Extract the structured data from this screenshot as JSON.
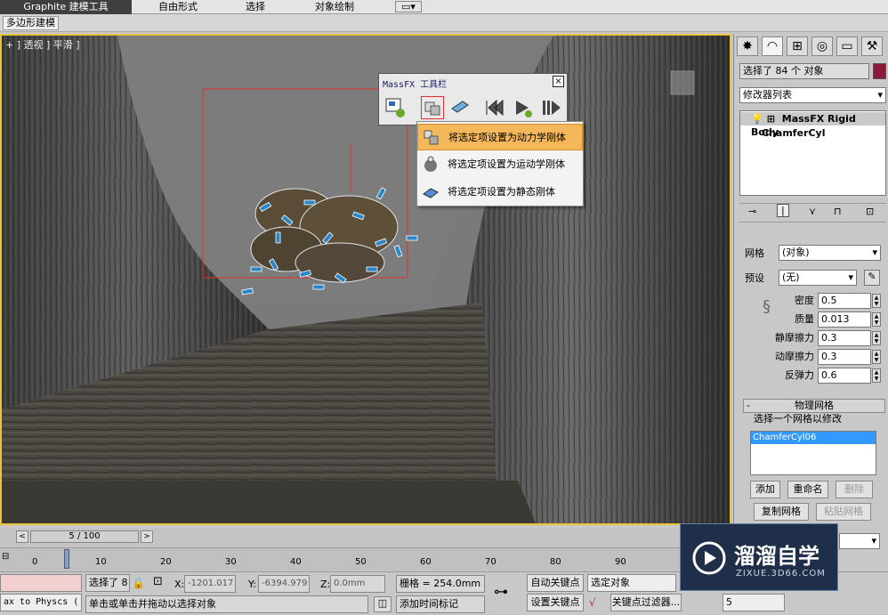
{
  "ribbon": {
    "tabs": [
      "Graphite 建模工具",
      "自由形式",
      "选择",
      "对象绘制"
    ],
    "sub_tab": "多边形建模"
  },
  "viewport": {
    "label": "+ ] 透视 ] 平滑 ]"
  },
  "massfx": {
    "title": "MassFX 工具栏",
    "close": "×"
  },
  "context_menu": {
    "items": [
      "将选定项设置为动力学刚体",
      "将选定项设置为运动学刚体",
      "将选定项设置为静态刚体"
    ]
  },
  "panel": {
    "selection_text": "选择了 84 个 对象",
    "modifier_list": "修改器列表",
    "stack": [
      "MassFX Rigid Body",
      "ChamferCyl"
    ],
    "mesh_label": "网格",
    "mesh_value": "(对象)",
    "preset_label": "预设",
    "preset_value": "(无)",
    "props": [
      {
        "label": "密度",
        "value": "0.5"
      },
      {
        "label": "质量",
        "value": "0.013"
      },
      {
        "label": "静摩擦力",
        "value": "0.3"
      },
      {
        "label": "动摩擦力",
        "value": "0.3"
      },
      {
        "label": "反弹力",
        "value": "0.6"
      }
    ],
    "rollout_title": "物理网格",
    "rollout_minus": "-",
    "select_mesh_label": "选择一个网格以修改",
    "mesh_list_item": "ChamferCyl06",
    "buttons": [
      "添加",
      "重命名",
      "删除",
      "复制网格",
      "粘贴网格"
    ]
  },
  "timeline": {
    "frame": "5 / 100",
    "ticks": [
      "0",
      "10",
      "20",
      "30",
      "40",
      "50",
      "60",
      "70",
      "80",
      "90"
    ]
  },
  "status": {
    "left_field": "ax to Physcs (",
    "selected": "选择了 8",
    "x_label": "X:",
    "x_value": "-1201.017",
    "y_label": "Y:",
    "y_value": "-6394.979",
    "z_label": "Z:",
    "z_value": "0.0mm",
    "grid": "栅格 = 254.0mm",
    "prompt": "单击或单击并拖动以选择对象",
    "add_time_tag": "添加时间标记",
    "auto_key": "自动关键点",
    "set_key": "设置关键点",
    "selection_set": "选定对象",
    "key_filter": "关键点过滤器...",
    "frame_field": "5"
  },
  "watermark": {
    "brand": "溜溜自学",
    "url": "ZIXUE.3D66.COM"
  }
}
